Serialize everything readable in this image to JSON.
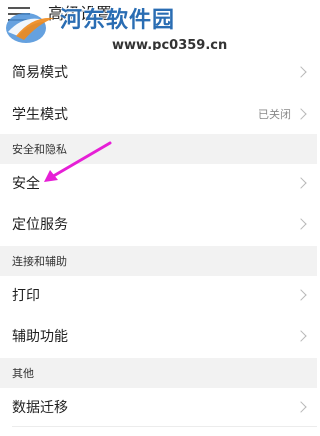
{
  "header": {
    "title": "高级设置"
  },
  "watermark": {
    "site_name": "河东软件园",
    "url": "www.pc0359.cn"
  },
  "rows": {
    "simple_mode": "简易模式",
    "student_mode": "学生模式",
    "student_mode_status": "已关闭",
    "security": "安全",
    "location": "定位服务",
    "print": "打印",
    "accessibility": "辅助功能",
    "data_migration": "数据迁移"
  },
  "sections": {
    "security_privacy": "安全和隐私",
    "connect_assist": "连接和辅助",
    "other": "其他"
  },
  "icons": {
    "menu": "menu-icon",
    "chevron": "chevron-right-icon",
    "arrow": "pointer-arrow-icon",
    "logo": "watermark-logo-icon"
  },
  "colors": {
    "background": "#ffffff",
    "section_background": "#f2f2f2",
    "chevron": "#b8b8b8",
    "status_text": "#8a8a8a",
    "annotation_arrow": "#e61fd6",
    "watermark_blue": "#2a6db3"
  }
}
